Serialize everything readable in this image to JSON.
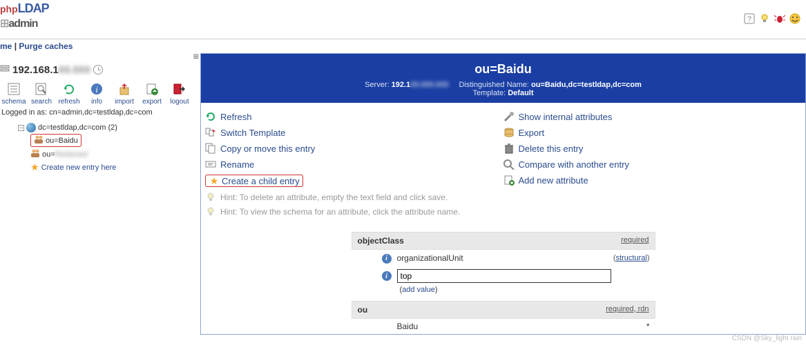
{
  "header": {
    "brand": {
      "p1": "php",
      "p2": "LDAP",
      "p3": "admin"
    }
  },
  "topbar": {
    "home": "me",
    "purge": "Purge caches"
  },
  "sidebar": {
    "server_ip_visible": "192.168.1",
    "toolbar": {
      "schema": "schema",
      "search": "search",
      "refresh": "refresh",
      "info": "info",
      "import": "import",
      "export": "export",
      "logout": "logout"
    },
    "logged_in_prefix": "Logged in as: ",
    "logged_in_dn": "cn=admin,dc=testldap,dc=com",
    "tree": {
      "root": "dc=testldap,dc=com (2)",
      "node1": "ou=Baidu",
      "node2_prefix": "ou=",
      "create": "Create new entry here"
    }
  },
  "entry": {
    "title": "ou=Baidu",
    "server_label": "Server: ",
    "server_value": "192.1",
    "dn_label": "Distinguished Name: ",
    "dn_value": "ou=Baidu,dc=testldap,dc=com",
    "template_label": "Template: ",
    "template_value": "Default"
  },
  "actions": {
    "left": {
      "refresh": "Refresh",
      "switch_template": "Switch Template",
      "copy_move": "Copy or move this entry",
      "rename": "Rename",
      "create_child": "Create a child entry"
    },
    "right": {
      "show_internal": "Show internal attributes",
      "export": "Export",
      "delete": "Delete this entry",
      "compare": "Compare with another entry",
      "add_attr": "Add new attribute"
    },
    "hint1": "Hint: To delete an attribute, empty the text field and click save.",
    "hint2": "Hint: To view the schema for an attribute, click the attribute name."
  },
  "attributes": {
    "objectClass": {
      "label": "objectClass",
      "required": "required",
      "value1": "organizationalUnit",
      "note1_prefix": "(",
      "note1_link": "structural",
      "note1_suffix": ")",
      "value2": "top",
      "add_value": "add value"
    },
    "ou": {
      "label": "ou",
      "required": "required",
      "rdn": "rdn",
      "value": "Baidu",
      "star": "*"
    }
  },
  "watermark": "CSDN @Sky_light rain"
}
